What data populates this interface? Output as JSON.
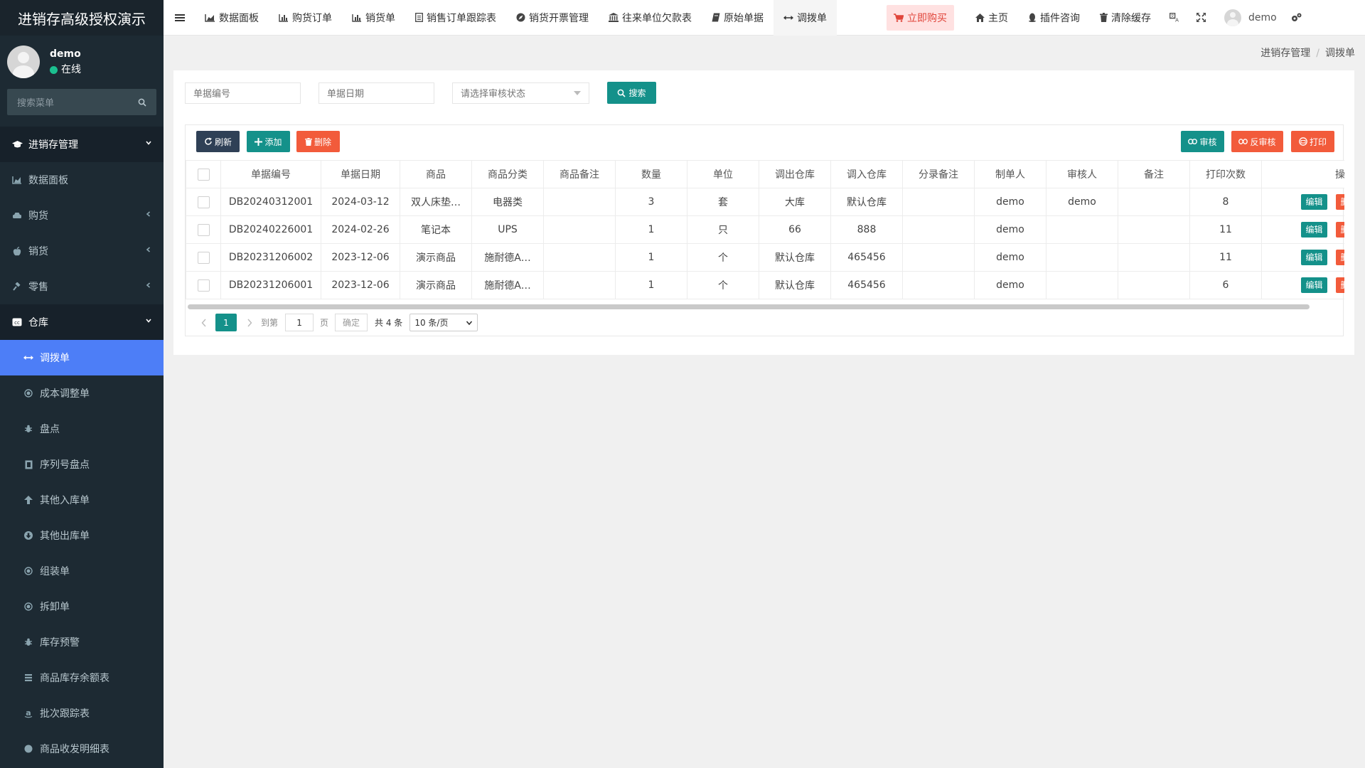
{
  "sidebar": {
    "brand": "进销存高级授权演示",
    "user": {
      "name": "demo",
      "status": "在线"
    },
    "search_placeholder": "搜索菜单",
    "items": [
      {
        "label": "进销存管理",
        "icon": "graduation-cap-icon"
      },
      {
        "label": "数据面板",
        "icon": "area-chart-icon"
      },
      {
        "label": "购货",
        "icon": "car-icon"
      },
      {
        "label": "销货",
        "icon": "apple-icon"
      },
      {
        "label": "零售",
        "icon": "gavel-icon"
      },
      {
        "label": "仓库",
        "icon": "cc-icon"
      },
      {
        "label": "调拨单",
        "icon": "arrows-h-icon"
      },
      {
        "label": "成本调整单",
        "icon": "dot-circle-icon"
      },
      {
        "label": "盘点",
        "icon": "bug-icon"
      },
      {
        "label": "序列号盘点",
        "icon": "file-icon"
      },
      {
        "label": "其他入库单",
        "icon": "arrow-up-icon"
      },
      {
        "label": "其他出库单",
        "icon": "arrow-circle-down-icon"
      },
      {
        "label": "组装单",
        "icon": "dot-circle-icon"
      },
      {
        "label": "拆卸单",
        "icon": "dot-circle-icon"
      },
      {
        "label": "库存预警",
        "icon": "bug-icon"
      },
      {
        "label": "商品库存余额表",
        "icon": "list-icon"
      },
      {
        "label": "批次跟踪表",
        "icon": "amazon-icon"
      },
      {
        "label": "商品收发明细表",
        "icon": "circle-icon"
      }
    ]
  },
  "topbar": {
    "tabs": [
      {
        "label": "数据面板",
        "icon": "area-chart-icon"
      },
      {
        "label": "购货订单",
        "icon": "bar-chart-icon"
      },
      {
        "label": "销货单",
        "icon": "bar-chart-icon"
      },
      {
        "label": "销售订单跟踪表",
        "icon": "file-text-icon"
      },
      {
        "label": "销货开票管理",
        "icon": "compass-icon"
      },
      {
        "label": "往来单位欠款表",
        "icon": "bank-icon"
      },
      {
        "label": "原始单据",
        "icon": "book-icon"
      },
      {
        "label": "调拨单",
        "icon": "arrows-h-icon"
      }
    ],
    "buy_label": "立即购买",
    "home_label": "主页",
    "plugin_label": "插件咨询",
    "clear_label": "清除缓存",
    "user_name": "demo"
  },
  "breadcrumb": [
    "进销存管理",
    "调拨单"
  ],
  "search": {
    "bill_no_placeholder": "单据编号",
    "bill_date_placeholder": "单据日期",
    "status_placeholder": "请选择审核状态",
    "search_label": "搜索"
  },
  "toolbar": {
    "refresh": "刷新",
    "add": "添加",
    "delete": "删除",
    "audit": "审核",
    "unaudit": "反审核",
    "print": "打印"
  },
  "table": {
    "columns": [
      "单据编号",
      "单据日期",
      "商品",
      "商品分类",
      "商品备注",
      "数量",
      "单位",
      "调出仓库",
      "调入仓库",
      "分录备注",
      "制单人",
      "审核人",
      "备注",
      "打印次数",
      "操作"
    ],
    "rows": [
      [
        "DB20240312001",
        "2024-03-12",
        "双人床垫…",
        "电器类",
        "",
        "3",
        "套",
        "大库",
        "默认仓库",
        "",
        "demo",
        "demo",
        "",
        "8"
      ],
      [
        "DB20240226001",
        "2024-02-26",
        "笔记本",
        "UPS",
        "",
        "1",
        "只",
        "66",
        "888",
        "",
        "demo",
        "",
        "",
        "11"
      ],
      [
        "DB20231206002",
        "2023-12-06",
        "演示商品",
        "施耐德A…",
        "",
        "1",
        "个",
        "默认仓库",
        "465456",
        "",
        "demo",
        "",
        "",
        "11"
      ],
      [
        "DB20231206001",
        "2023-12-06",
        "演示商品",
        "施耐德A…",
        "",
        "1",
        "个",
        "默认仓库",
        "465456",
        "",
        "demo",
        "",
        "",
        "6"
      ]
    ],
    "edit_label": "编辑",
    "delete_label": "删除"
  },
  "pagination": {
    "current_page": "1",
    "goto_label": "到第",
    "goto_value": "1",
    "page_unit": "页",
    "confirm_label": "确定",
    "total_label": "共 4 条",
    "page_size": "10 条/页"
  },
  "colors": {
    "sidebar_bg": "#1d2a33",
    "active_menu": "#4d7ef7",
    "primary": "#14918a",
    "danger": "#f25b3b",
    "dark_button": "#2f4056"
  }
}
